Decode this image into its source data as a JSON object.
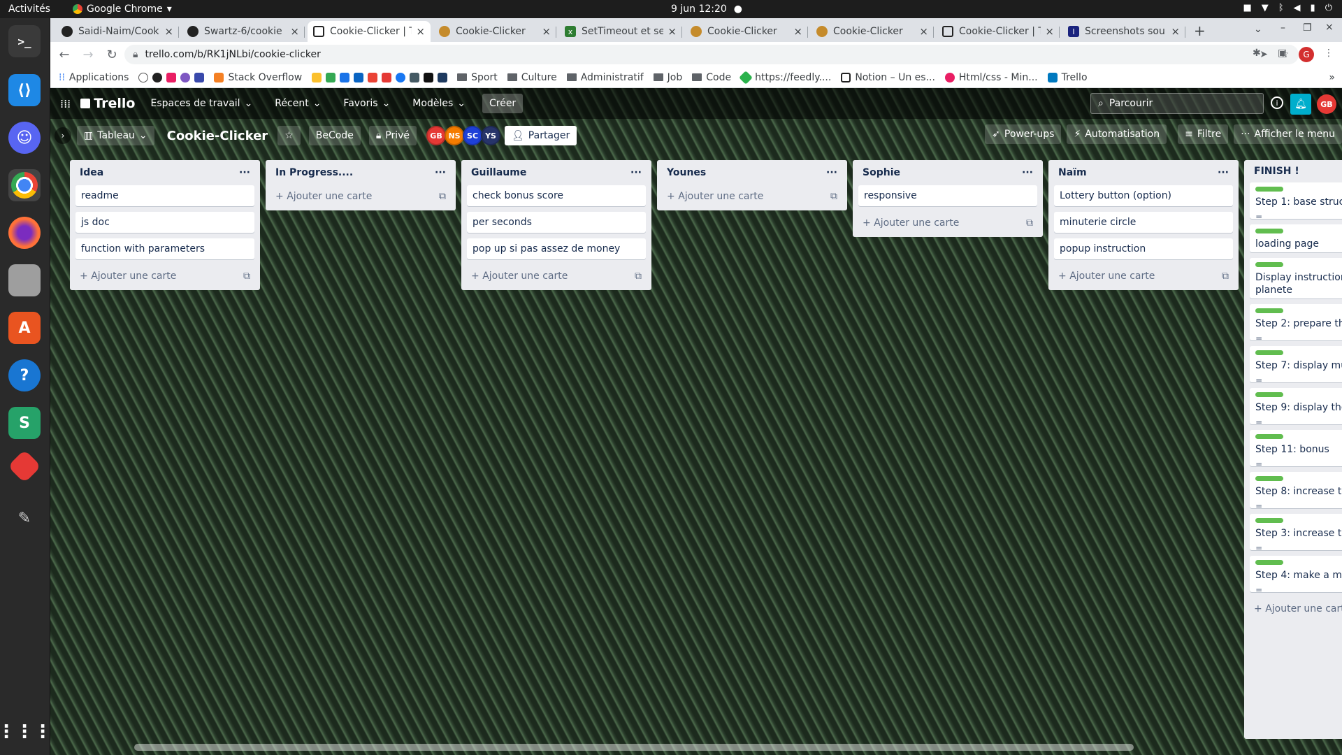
{
  "system": {
    "activities": "Activités",
    "app_name": "Google Chrome",
    "clock": "9 jun  12:20"
  },
  "tabs": [
    {
      "title": "Saidi-Naim/Cook",
      "icon": "github-icon"
    },
    {
      "title": "Swartz-6/cookie",
      "icon": "github-icon"
    },
    {
      "title": "Cookie-Clicker | T",
      "icon": "trello-icon",
      "active": true
    },
    {
      "title": "Cookie-Clicker",
      "icon": "cookie-icon"
    },
    {
      "title": "SetTimeout et se",
      "icon": "xul-icon"
    },
    {
      "title": "Cookie-Clicker",
      "icon": "cookie-icon"
    },
    {
      "title": "Cookie-Clicker",
      "icon": "cookie-icon"
    },
    {
      "title": "Cookie-Clicker | T",
      "icon": "trello-icon"
    },
    {
      "title": "Screenshots sou",
      "icon": "doc-icon"
    }
  ],
  "address": {
    "url": "trello.com/b/RK1jNLbi/cookie-clicker",
    "profile": "G"
  },
  "bookmarks": [
    "Applications",
    "Stack Overflow",
    "Sport",
    "Culture",
    "Administratif",
    "Job",
    "Code",
    "https://feedly....",
    "Notion – Un es...",
    "Html/css - Min...",
    "Trello"
  ],
  "trello": {
    "logo": "Trello",
    "menu": [
      "Espaces de travail",
      "Récent",
      "Favoris",
      "Modèles"
    ],
    "create": "Créer",
    "search_placeholder": "Parcourir",
    "user": "GB"
  },
  "board": {
    "view": "Tableau",
    "title": "Cookie-Clicker",
    "workspace": "BeCode",
    "visibility": "Privé",
    "members": [
      "GB",
      "NS",
      "SC",
      "YS"
    ],
    "share": "Partager",
    "powerups": "Power-ups",
    "automation": "Automatisation",
    "filter": "Filtre",
    "menu": "Afficher le menu"
  },
  "add_card": "Ajouter une carte",
  "lists": [
    {
      "title": "Idea",
      "cards": [
        "readme",
        "js doc",
        "function with parameters"
      ]
    },
    {
      "title": "In Progress....",
      "cards": []
    },
    {
      "title": "Guillaume",
      "cards": [
        "check bonus score",
        "per seconds",
        "pop up si pas assez de money"
      ]
    },
    {
      "title": "Younes",
      "cards": []
    },
    {
      "title": "Sophie",
      "cards": [
        "responsive"
      ]
    },
    {
      "title": "Naïm",
      "cards": [
        "Lottery button (option)",
        "minuterie circle",
        "popup instruction"
      ]
    },
    {
      "title": "FINISH !",
      "cards": [
        "Step 1: base structu",
        "loading page",
        "Display instruction c planete",
        "Step 2: prepare the",
        "Step 7: display mult",
        "Step 9: display the c",
        "Step 11: bonus",
        "Step 8: increase the",
        "Step 3: increase the",
        "Step 4: make a mult"
      ]
    }
  ],
  "colors": {
    "accent": "#0079bf",
    "label_green": "#61bd4f",
    "avatar_gb": "#e53935",
    "avatar_ns": "#f57c00",
    "avatar_sc": "#1e40d8",
    "avatar_ys": "#27346a"
  }
}
